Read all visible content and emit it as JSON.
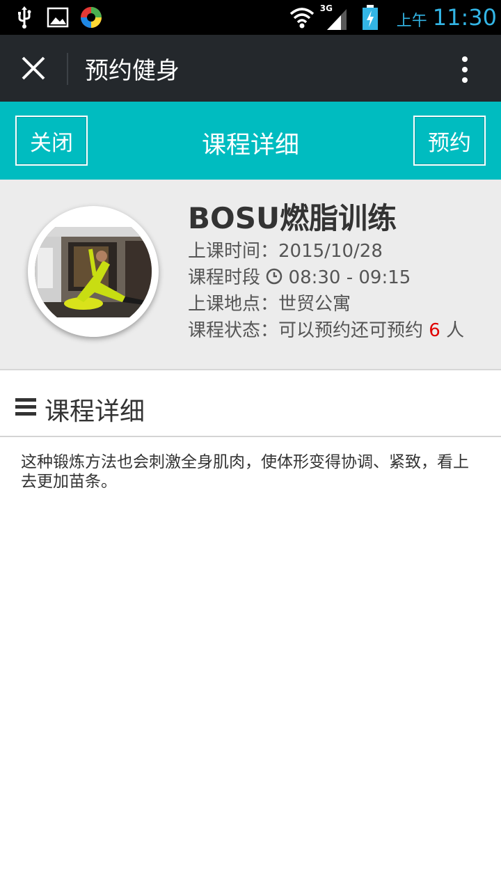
{
  "status_bar": {
    "time_prefix": "上午",
    "time": "11:30",
    "network": "3G",
    "icons": [
      "usb-icon",
      "image-icon",
      "app-icon",
      "wifi-icon",
      "signal-icon",
      "battery-charging-icon"
    ]
  },
  "app_bar": {
    "title": "预约健身",
    "close_icon": "close-icon",
    "more_icon": "more-vert-icon"
  },
  "header": {
    "left_button": "关闭",
    "title": "课程详细",
    "right_button": "预约",
    "color": "#00bcc0"
  },
  "course": {
    "name": "BOSU燃脂训练",
    "date_label": "上课时间：",
    "date": "2015/10/28",
    "period_label": "课程时段",
    "period": "08:30 - 09:15",
    "location_label": "上课地点：",
    "location": "世贸公寓",
    "status_label": "课程状态：",
    "status": "可以预约还可预约",
    "remaining": "6",
    "unit": "人"
  },
  "detail": {
    "section_title": "课程详细",
    "description": "这种锻炼方法也会刺激全身肌肉，使体形变得协调、紧致，看上去更加苗条。"
  }
}
